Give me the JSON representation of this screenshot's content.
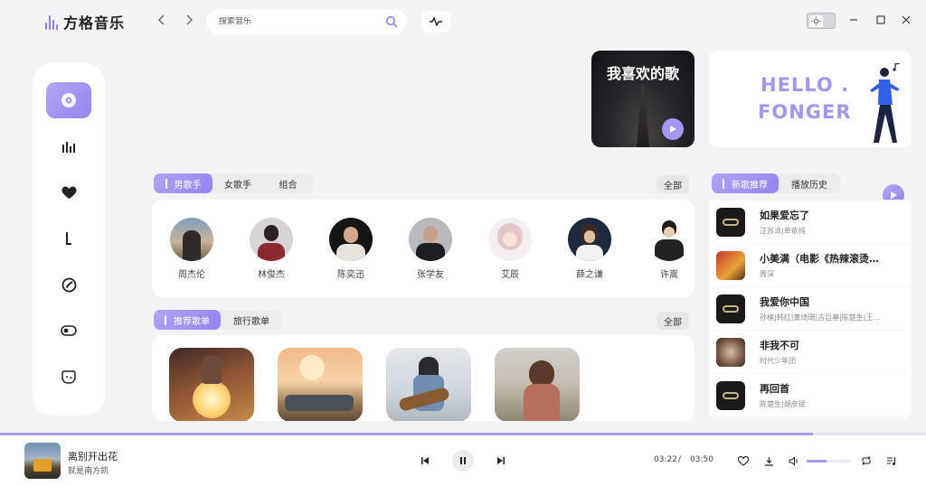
{
  "app": {
    "name": "方格音乐"
  },
  "search": {
    "placeholder": "搜索音乐"
  },
  "colors": {
    "accent": "#9a8aef",
    "accent_light": "#b3a6f6"
  },
  "sidebar": {
    "items": [
      {
        "icon": "disc-icon",
        "active": true
      },
      {
        "icon": "bar-chart-icon"
      },
      {
        "icon": "heart-icon"
      },
      {
        "icon": "music-note-icon"
      },
      {
        "icon": "compass-icon"
      },
      {
        "icon": "toggle-icon"
      },
      {
        "icon": "smile-icon"
      }
    ]
  },
  "banners": {
    "favorite_title": "我喜欢的歌",
    "hello_line1": "HELLO .",
    "hello_line2": "FONGER"
  },
  "singers_section": {
    "tabs": [
      "男歌手",
      "女歌手",
      "组合"
    ],
    "all_label": "全部",
    "singers": [
      "周杰伦",
      "林俊杰",
      "陈奕迅",
      "张学友",
      "艾辰",
      "薛之谦",
      "许嵩"
    ]
  },
  "playlist_section": {
    "tabs": [
      "推荐歌单",
      "旅行歌单"
    ],
    "all_label": "全部"
  },
  "right_panel": {
    "tabs": [
      "新歌推荐",
      "播放历史"
    ],
    "songs": [
      {
        "title": "如果爱忘了",
        "artist": "汪苏泷|单依纯"
      },
      {
        "title": "小美满（电影《热辣滚烫》…",
        "artist": "周深"
      },
      {
        "title": "我爱你中国",
        "artist": "孙楠|韩红|黄绮珊|古巨基|陈楚生|王…"
      },
      {
        "title": "非我不可",
        "artist": "时代少年团"
      },
      {
        "title": "再回首",
        "artist": "陈楚生|胡彦斌"
      }
    ]
  },
  "player": {
    "title": "离别开出花",
    "artist": "就是南方凯",
    "current_time": "03:22",
    "separator": "/",
    "total_time": "03:50",
    "progress": 0.878,
    "volume": 0.45
  }
}
